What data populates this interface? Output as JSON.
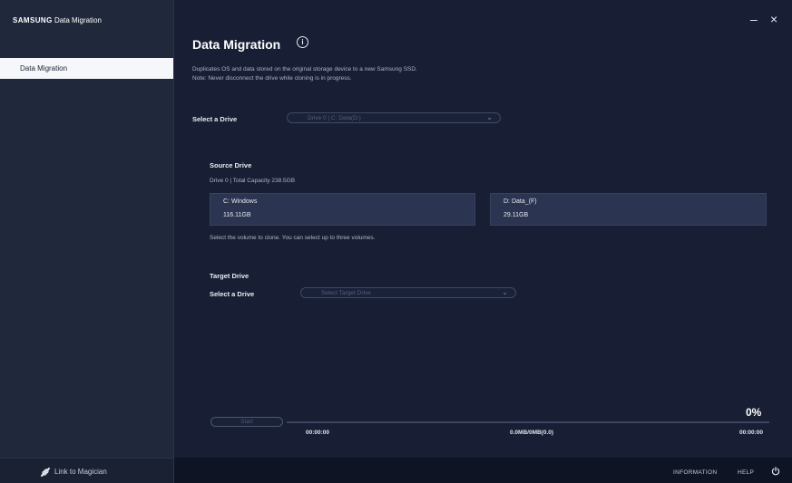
{
  "app": {
    "brand_bold": "SAMSUNG",
    "brand_rest": "Data Migration"
  },
  "window": {
    "minimize": "–",
    "close": "×"
  },
  "sidebar": {
    "items": [
      {
        "label": "Data Migration"
      }
    ],
    "bottom_link": "Link to Magician"
  },
  "main": {
    "title": "Data Migration",
    "info_symbol": "i",
    "description_line1": "Duplicates OS and data stored on the original storage device to a new Samsung SSD.",
    "description_line2": "Note: Never disconnect the drive while cloning is in progress.",
    "select_drive_label": "Select a Drive",
    "select_drive_placeholder": "Drive 0 | C: Data(D:)",
    "source": {
      "heading": "Source Drive",
      "drive_info": "Drive 0 | Total Capacity 238.5GB",
      "volumes": [
        {
          "name": "C: Windows",
          "size": "116.11GB"
        },
        {
          "name": "D: Data_(F)",
          "size": "29.11GB"
        }
      ],
      "hint": "Select the volume to clone. You can select up to three volumes."
    },
    "target": {
      "heading": "Target Drive",
      "select_label": "Select a Drive",
      "select_placeholder": "Select Target Drive"
    },
    "progress": {
      "value_percent": 0,
      "percent_text": "0%",
      "start_label": "Start",
      "labels": [
        "00:00:00",
        "0.0MB/0MB(0.0)",
        "00:00:00"
      ]
    }
  },
  "bottombar": {
    "information": "INFORMATION",
    "help": "HELP"
  },
  "colors": {
    "background": "#161d31",
    "sidebar": "#20283b",
    "selected_nav": "#f5f7fb",
    "volume_box": "#2b3450"
  }
}
